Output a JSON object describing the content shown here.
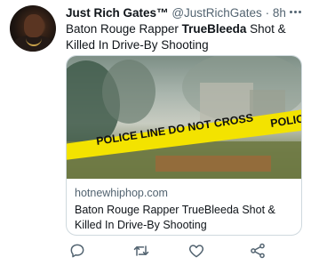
{
  "tweet": {
    "author_name": "Just Rich Gates™",
    "author_handle": "@JustRichGates",
    "separator": "·",
    "time": "8h",
    "text_before": "Baton Rouge Rapper ",
    "text_bold": "TrueBleeda",
    "text_after": " Shot & Killed In Drive-By Shooting"
  },
  "card": {
    "tape_text": "POLICE LINE DO NOT CROSS",
    "tape_text_2": "POLIC",
    "domain": "hotnewhiphop.com",
    "title": "Baton Rouge Rapper TrueBleeda Shot & Killed In Drive-By Shooting"
  },
  "actions": {
    "icons": [
      "reply-icon",
      "retweet-icon",
      "like-icon",
      "share-icon"
    ]
  },
  "colors": {
    "text": "#0f1419",
    "secondary": "#536471",
    "border": "#cfd9de",
    "tape": "#f3e300"
  }
}
